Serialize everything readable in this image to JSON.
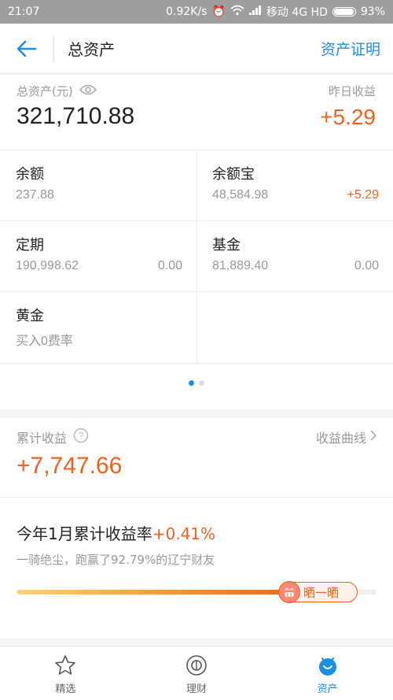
{
  "status_bar": {
    "time": "21:07",
    "speed": "0.92K/s",
    "carrier": "移动 4G HD",
    "battery": "93%"
  },
  "nav": {
    "title": "总资产",
    "action": "资产证明"
  },
  "summary": {
    "total_label": "总资产(元)",
    "total_value": "321,710.88",
    "yesterday_label": "昨日收益",
    "yesterday_value": "+5.29"
  },
  "assets": [
    {
      "name": "余额",
      "value": "237.88",
      "side": ""
    },
    {
      "name": "余额宝",
      "value": "48,584.98",
      "side": "+5.29"
    },
    {
      "name": "定期",
      "value": "190,998.62",
      "side": "0.00"
    },
    {
      "name": "基金",
      "value": "81,889.40",
      "side": "0.00"
    },
    {
      "name": "黄金",
      "value": "买入0费率",
      "side": ""
    }
  ],
  "earnings": {
    "label": "累计收益",
    "curve_link": "收益曲线",
    "value": "+7,747.66"
  },
  "rate": {
    "prefix": "今年1月累计收益率",
    "pct": "+0.41%",
    "subtitle": "一骑绝尘，跑赢了92.79%的辽宁财友",
    "progress": 0.79,
    "badge": "晒一晒"
  },
  "tabs": [
    {
      "label": "精选",
      "icon": "star-icon"
    },
    {
      "label": "理财",
      "icon": "finance-icon"
    },
    {
      "label": "资产",
      "icon": "assets-icon"
    }
  ],
  "colors": {
    "accent": "#1a8fe3",
    "positive": "#f0601e"
  }
}
